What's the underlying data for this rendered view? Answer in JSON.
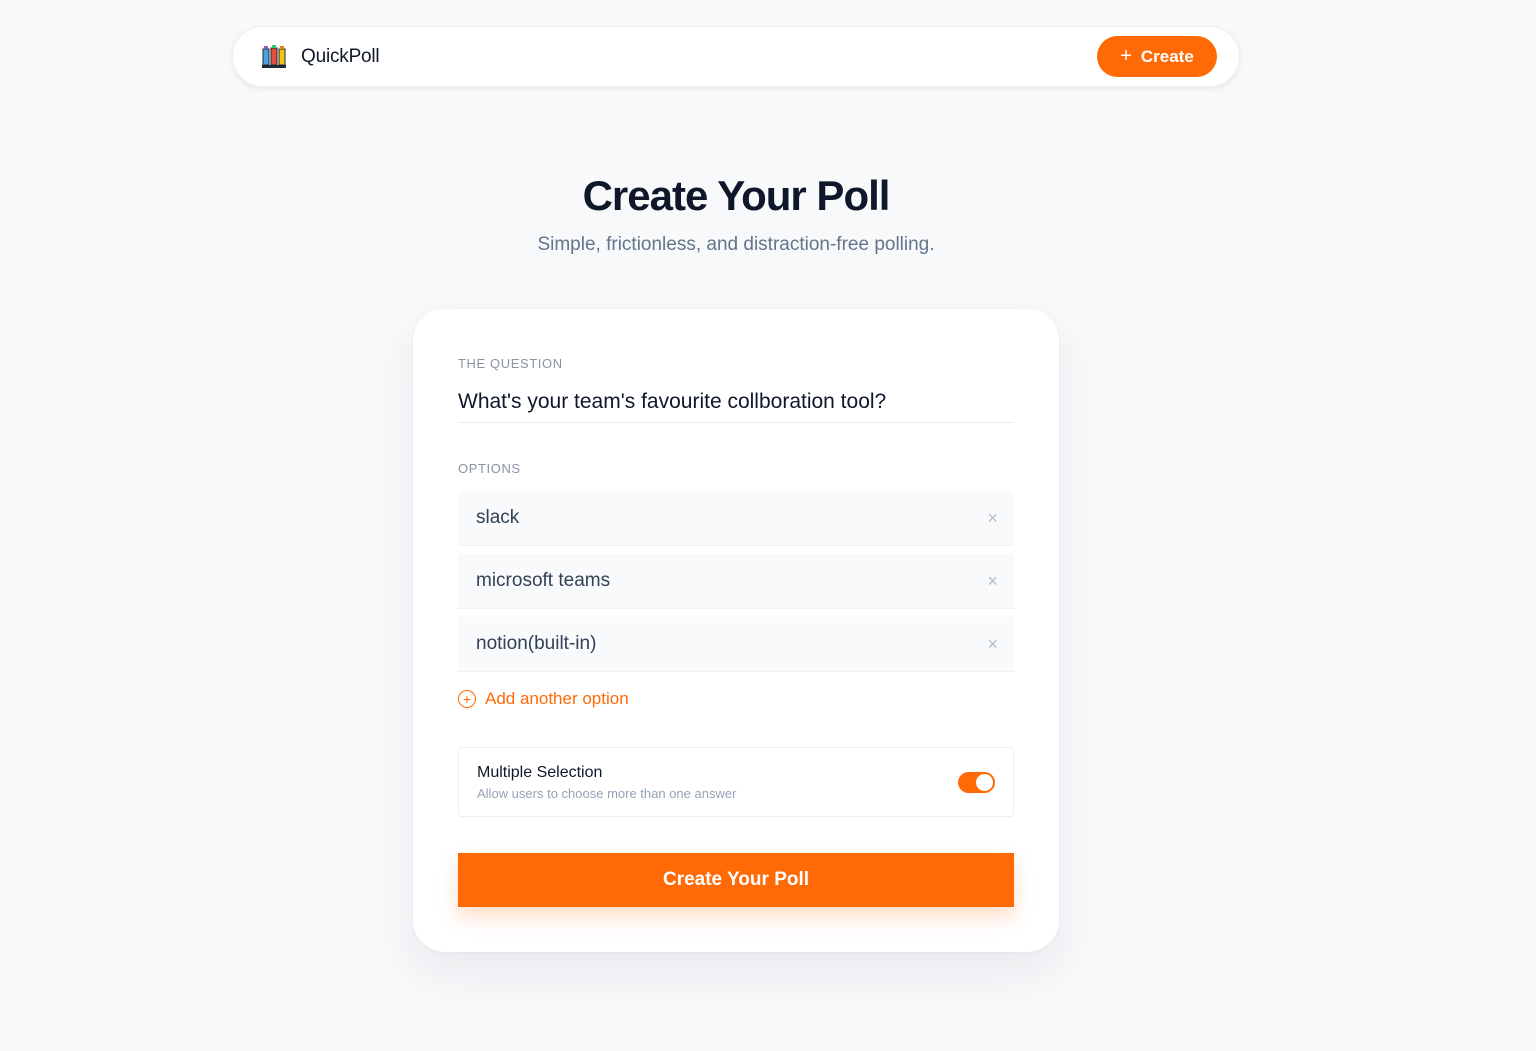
{
  "navbar": {
    "brand_name": "QuickPoll",
    "brand_icon": "books-icon",
    "create_icon": "+",
    "create_label": "Create"
  },
  "hero": {
    "title": "Create Your Poll",
    "subtitle": "Simple, frictionless, and distraction-free polling."
  },
  "form": {
    "question_label": "THE QUESTION",
    "question_value": "What's your team's favourite collboration tool?",
    "options_label": "OPTIONS",
    "options": [
      {
        "value": "slack"
      },
      {
        "value": "microsoft teams"
      },
      {
        "value": "notion(built-in)"
      }
    ],
    "remove_icon": "×",
    "add_icon": "+",
    "add_option_label": "Add another option",
    "multiple_selection": {
      "title": "Multiple Selection",
      "subtitle": "Allow users to choose more than one answer",
      "enabled": true
    },
    "submit_label": "Create Your Poll"
  },
  "colors": {
    "accent": "#ff6a06",
    "background": "#f8f9fb",
    "text": "#0f172a",
    "muted": "#64748b"
  }
}
